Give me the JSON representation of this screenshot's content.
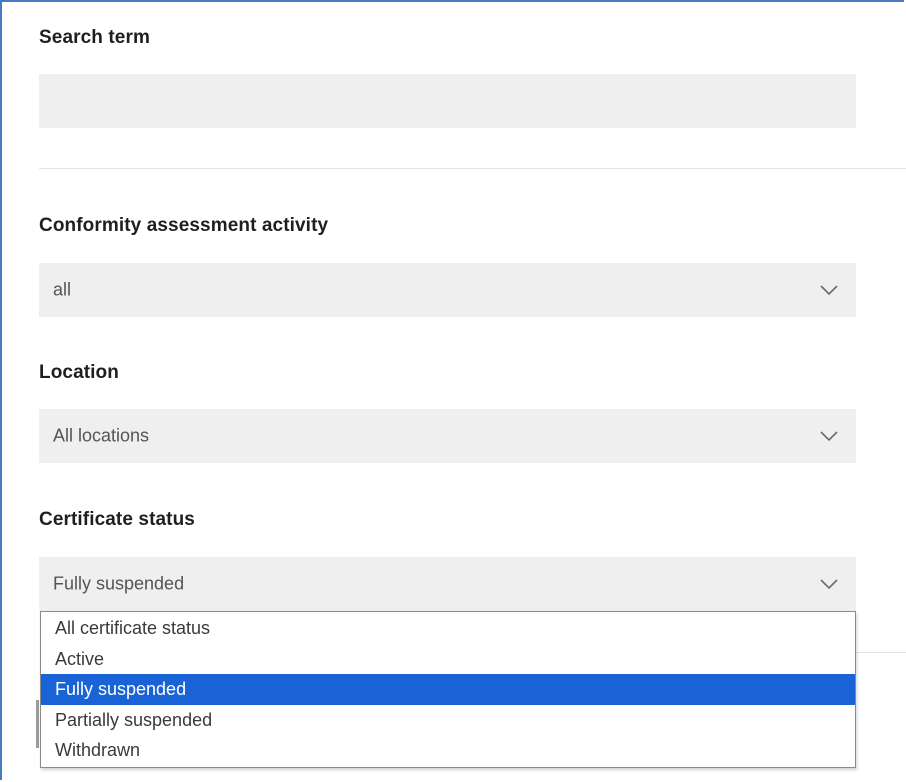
{
  "search": {
    "label": "Search term",
    "value": "",
    "placeholder": ""
  },
  "activity": {
    "label": "Conformity assessment activity",
    "value": "all"
  },
  "location": {
    "label": "Location",
    "value": "All locations"
  },
  "certificate_status": {
    "label": "Certificate status",
    "value": "Fully suspended",
    "options": [
      "All certificate status",
      "Active",
      "Fully suspended",
      "Partially suspended",
      "Withdrawn"
    ],
    "selected_index": 2
  },
  "colors": {
    "field_bg": "#efefef",
    "selected_bg": "#1a63d6",
    "frame_border": "#4a78c2"
  },
  "icons": {
    "dropdown": "chevron-down-icon"
  }
}
